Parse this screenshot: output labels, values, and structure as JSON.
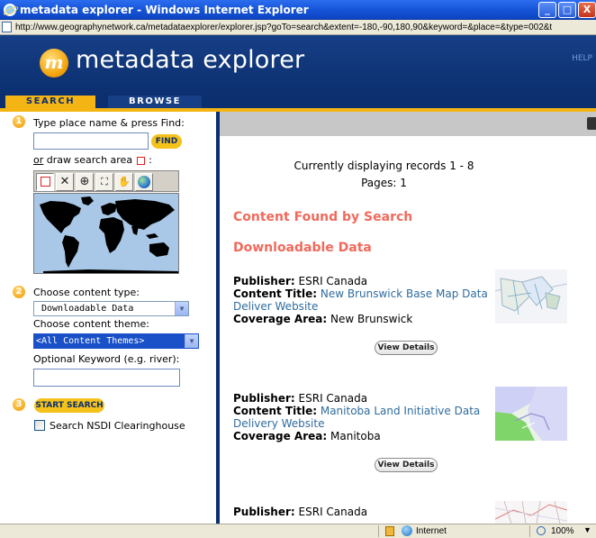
{
  "browser": {
    "title": "metadata explorer - Windows Internet Explorer",
    "url": "http://www.geographynetwork.ca/metadataexplorer/explorer.jsp?goTo=search&extent=-180,-90,180,90&keyword=&place=&type=002&t",
    "window_buttons": {
      "minimize": "_",
      "maximize": "□",
      "close": "X"
    }
  },
  "header": {
    "logo_letter": "m",
    "app_name": "metadata explorer",
    "help": "HELP"
  },
  "tabs": [
    {
      "label": "SEARCH",
      "active": true
    },
    {
      "label": "BROWSE",
      "active": false
    }
  ],
  "sidebar": {
    "step1": {
      "number": "1",
      "label": "Type place name & press Find:",
      "place_value": "",
      "find_label": "FIND",
      "draw_or": "or",
      "draw_rest": " draw search area",
      "draw_colon": " :"
    },
    "tools": [
      {
        "icon": "draw-rectangle-icon",
        "glyph": "□"
      },
      {
        "icon": "clear-icon",
        "glyph": "✕"
      },
      {
        "icon": "zoom-in-icon",
        "glyph": "⊕"
      },
      {
        "icon": "full-extent-icon",
        "glyph": "⛶"
      },
      {
        "icon": "pan-hand-icon",
        "glyph": "✋"
      },
      {
        "icon": "globe-icon",
        "glyph": "●"
      }
    ],
    "step2": {
      "number": "2",
      "type_label": "Choose content type:",
      "type_value": "Downloadable Data",
      "theme_label": "Choose content theme:",
      "theme_value": "<All Content Themes>",
      "keyword_label": "Optional Keyword (e.g. river):",
      "keyword_value": ""
    },
    "step3": {
      "number": "3",
      "start_label": "START SEARCH",
      "nsdi_label": "Search NSDI Clearinghouse",
      "nsdi_checked": false
    }
  },
  "main": {
    "records_text": "Currently displaying records 1 - 8",
    "pages_text": "Pages: 1",
    "heading1": "Content Found by Search",
    "heading2": "Downloadable Data",
    "field_labels": {
      "publisher": "Publisher:",
      "title": "Content Title:",
      "area": "Coverage Area:"
    },
    "view_label": "View Details",
    "records": [
      {
        "publisher": "ESRI Canada",
        "title_line1": "New Brunswick Base Map Data",
        "title_line2": "Deliver Website",
        "area": "New Brunswick"
      },
      {
        "publisher": "ESRI Canada",
        "title_line1": "Manitoba Land Initiative Data",
        "title_line2": "Delivery Website",
        "area": "Manitoba"
      },
      {
        "publisher": "ESRI Canada",
        "title_line1": "",
        "title_line2": "",
        "area": ""
      }
    ]
  },
  "statusbar": {
    "zone": "Internet",
    "zoom": "100%"
  },
  "colors": {
    "navy": "#0b2f6f",
    "gold": "#f4b514",
    "heading_red": "#f06a5c",
    "link_blue": "#2f6c9e"
  }
}
